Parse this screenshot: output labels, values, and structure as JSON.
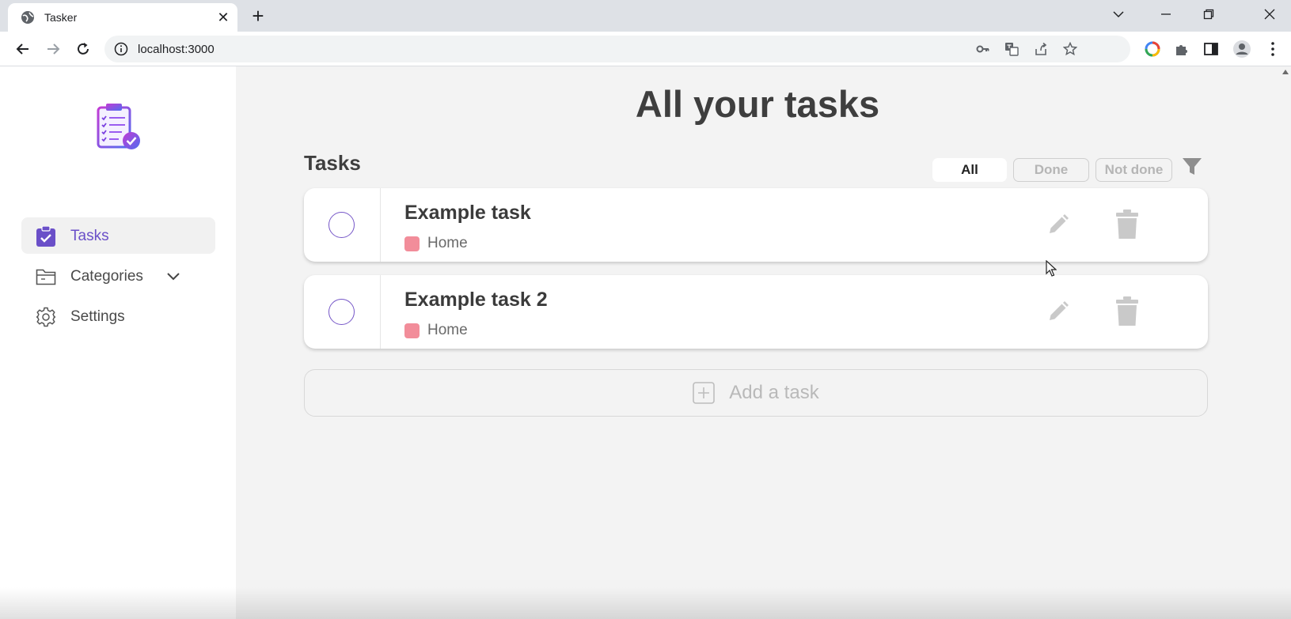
{
  "browser": {
    "tab_title": "Tasker",
    "url": "localhost:3000",
    "new_tab_symbol": "+",
    "close_symbol": "✕"
  },
  "sidebar": {
    "items": [
      {
        "label": "Tasks",
        "icon": "clipboard-check-icon",
        "active": true
      },
      {
        "label": "Categories",
        "icon": "folder-icon",
        "active": false
      },
      {
        "label": "Settings",
        "icon": "gear-icon",
        "active": false
      }
    ]
  },
  "main": {
    "title": "All your tasks",
    "section_title": "Tasks",
    "filters": [
      {
        "label": "All",
        "active": true
      },
      {
        "label": "Done",
        "active": false
      },
      {
        "label": "Not done",
        "active": false
      }
    ],
    "tasks": [
      {
        "name": "Example task",
        "category": "Home",
        "category_color": "#f28d9a",
        "done": false
      },
      {
        "name": "Example task 2",
        "category": "Home",
        "category_color": "#f28d9a",
        "done": false
      }
    ],
    "add_task_label": "Add a task"
  },
  "colors": {
    "accent": "#6a4fc8",
    "page_bg": "#f3f3f3"
  }
}
